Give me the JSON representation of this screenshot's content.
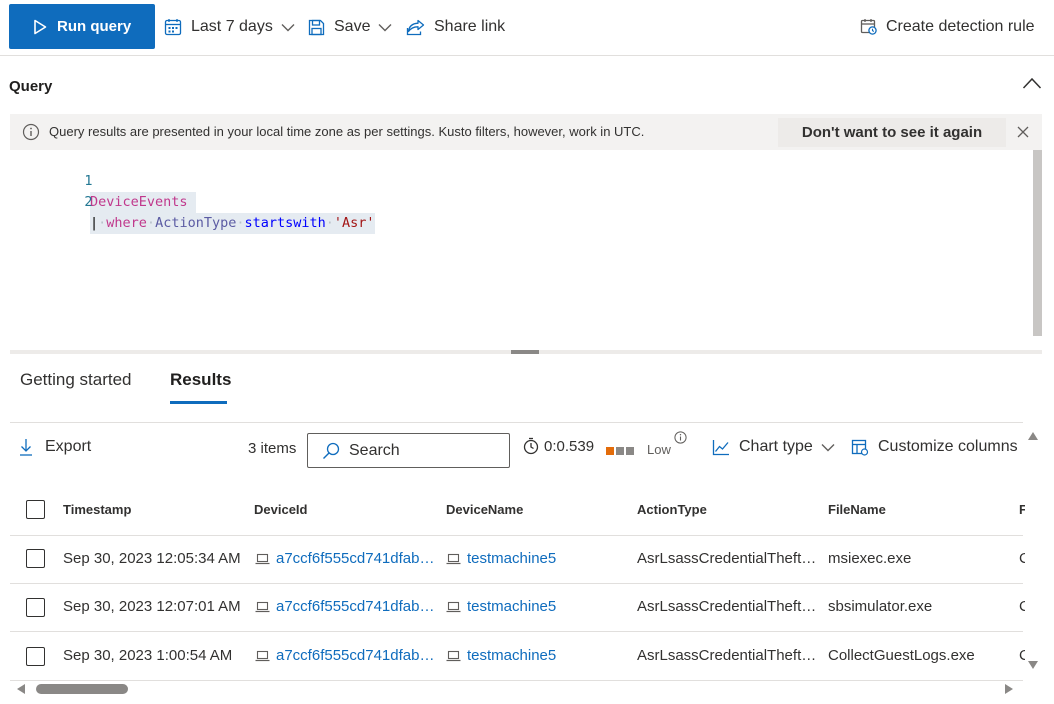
{
  "toolbar": {
    "run_label": "Run query",
    "time_range_label": "Last 7 days",
    "save_label": "Save",
    "share_label": "Share link",
    "detection_label": "Create detection rule"
  },
  "query_section": {
    "title": "Query",
    "info_message": "Query results are presented in your local time zone as per settings. Kusto filters, however, work in UTC.",
    "dont_show_label": "Don't want to see it again"
  },
  "editor": {
    "line_numbers": [
      "1",
      "2"
    ],
    "line1": {
      "table": "DeviceEvents"
    },
    "line2": {
      "pipe": "|",
      "op": "where",
      "field": "ActionType",
      "func": "startswith",
      "value": "'Asr'"
    }
  },
  "tabs": [
    {
      "label": "Getting started",
      "active": false
    },
    {
      "label": "Results",
      "active": true
    }
  ],
  "results_toolbar": {
    "export_label": "Export",
    "item_count": "3 items",
    "search_placeholder": "Search",
    "duration": "0:0.539",
    "level_label": "Low",
    "chart_type_label": "Chart type",
    "customize_label": "Customize columns"
  },
  "table": {
    "columns": [
      "Timestamp",
      "DeviceId",
      "DeviceName",
      "ActionType",
      "FileName",
      "F"
    ],
    "rows": [
      {
        "timestamp": "Sep 30, 2023 12:05:34 AM",
        "device_id": "a7ccf6f555cd741dfab…",
        "device_name": "testmachine5",
        "action_type": "AsrLsassCredentialTheft…",
        "file_name": "msiexec.exe",
        "extra": "C"
      },
      {
        "timestamp": "Sep 30, 2023 12:07:01 AM",
        "device_id": "a7ccf6f555cd741dfab…",
        "device_name": "testmachine5",
        "action_type": "AsrLsassCredentialTheft…",
        "file_name": "sbsimulator.exe",
        "extra": "C"
      },
      {
        "timestamp": "Sep 30, 2023 1:00:54 AM",
        "device_id": "a7ccf6f555cd741dfab…",
        "device_name": "testmachine5",
        "action_type": "AsrLsassCredentialTheft…",
        "file_name": "CollectGuestLogs.exe",
        "extra": "C"
      }
    ]
  },
  "colors": {
    "accent": "#0f6cbd",
    "level_low": "#e36c0a",
    "level_inactive": "#8a8886",
    "code_keyword_pink": "#c0388c",
    "code_string": "#a31515"
  },
  "icons": {
    "run": "play-icon",
    "time": "calendar-icon",
    "save": "floppy-icon",
    "share": "share-icon",
    "detection": "detection-rule-icon",
    "export": "download-icon",
    "search": "search-icon",
    "timer": "stopwatch-icon",
    "chart": "line-chart-icon",
    "columns": "columns-icon",
    "device": "laptop-icon"
  }
}
